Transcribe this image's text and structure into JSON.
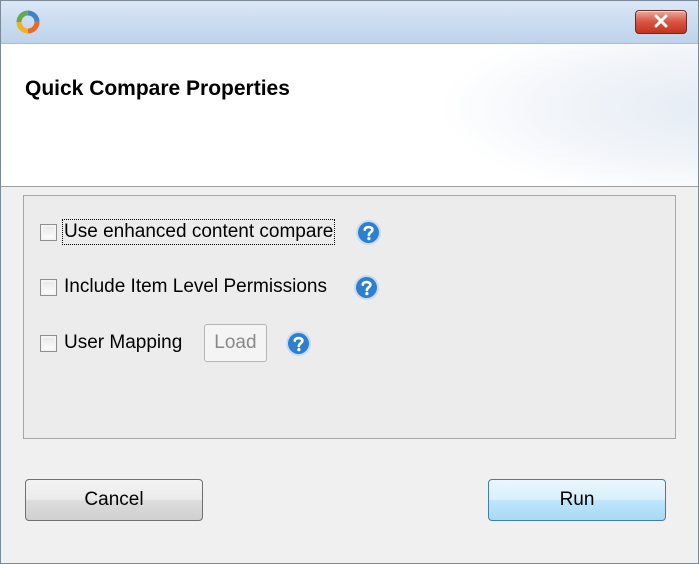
{
  "dialog": {
    "title": "Quick Compare Properties"
  },
  "options": [
    {
      "label": "Use enhanced content compare",
      "checked": false
    },
    {
      "label": "Include Item Level Permissions",
      "checked": false
    },
    {
      "label": "User Mapping",
      "checked": false
    }
  ],
  "load_button": {
    "label": "Load",
    "enabled": false
  },
  "buttons": {
    "cancel_label": "Cancel",
    "run_label": "Run"
  },
  "icons": {
    "app": "app-logo-icon",
    "close": "close-icon",
    "help": "help-question-icon"
  },
  "colors": {
    "close_button": "#d9533f",
    "help_icon": "#2f7fd0",
    "default_button": "#bee6fd"
  }
}
